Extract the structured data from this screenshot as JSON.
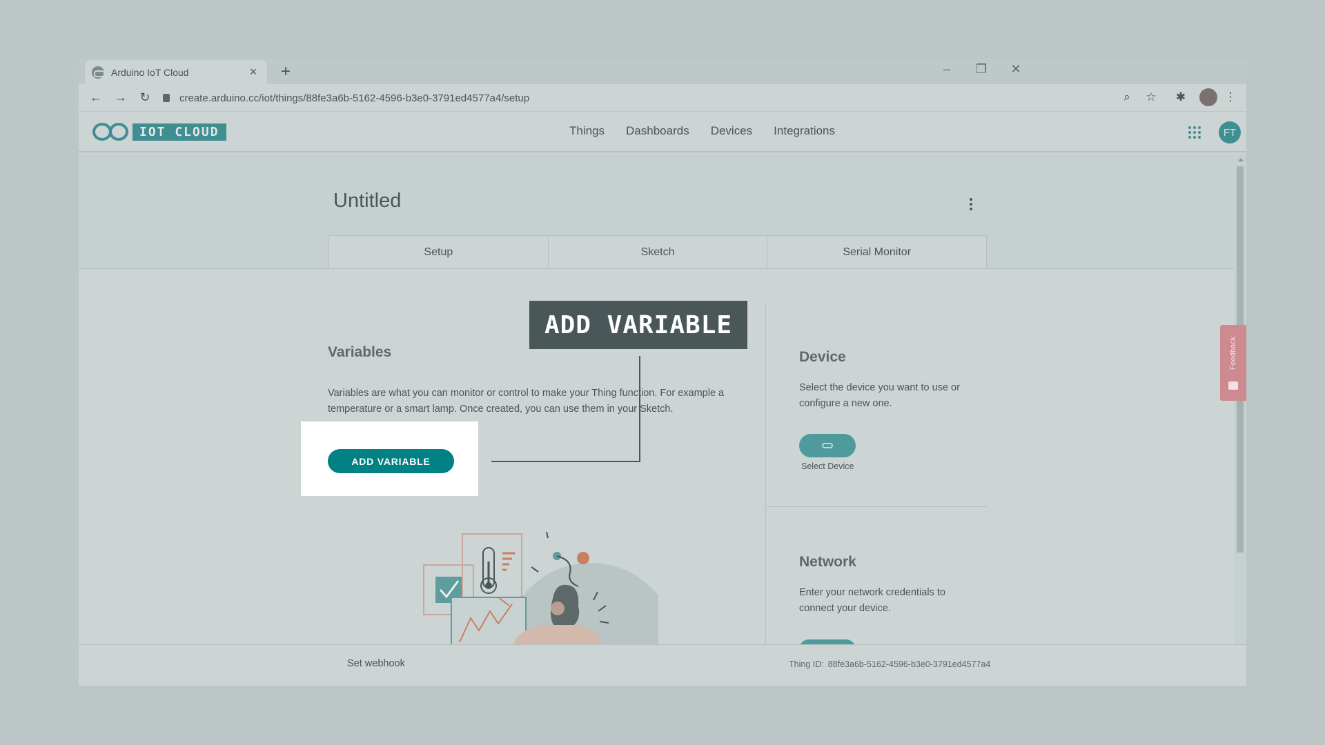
{
  "browser": {
    "tab_title": "Arduino IoT Cloud",
    "tab_close": "×",
    "new_tab": "+",
    "url": "create.arduino.cc/iot/things/88fe3a6b-5162-4596-b3e0-3791ed4577a4/setup",
    "controls": {
      "minimize": "–",
      "restore": "❐",
      "close": "✕"
    },
    "nav": {
      "back": "←",
      "forward": "→",
      "reload": "↻"
    },
    "toolbar_icons": {
      "zoom": "⌕",
      "star": "☆",
      "extensions": "✱",
      "menu": "⋮"
    }
  },
  "header": {
    "logo_text": "IOT CLOUD",
    "nav": [
      "Things",
      "Dashboards",
      "Devices",
      "Integrations"
    ],
    "avatar": "FT"
  },
  "thing": {
    "title": "Untitled",
    "tabs": [
      "Setup",
      "Sketch",
      "Serial Monitor"
    ]
  },
  "variables": {
    "title": "Variables",
    "description": "Variables are what you can monitor or control to make your Thing function. For example a temperature or a smart lamp. Once created, you can use them in your Sketch.",
    "button": "ADD VARIABLE"
  },
  "device": {
    "title": "Device",
    "description": "Select the device you want to use or configure a new one.",
    "button_caption": "Select Device"
  },
  "network": {
    "title": "Network",
    "description": "Enter your network credentials to connect your device."
  },
  "footer": {
    "webhook": "Set webhook",
    "thing_id_label": "Thing ID:",
    "thing_id": "88fe3a6b-5162-4596-b3e0-3791ed4577a4"
  },
  "feedback": "Feedback",
  "callout": "ADD VARIABLE",
  "colors": {
    "accent": "#008184",
    "callout_bg": "#4a5759",
    "feedback": "#cd8a90"
  }
}
